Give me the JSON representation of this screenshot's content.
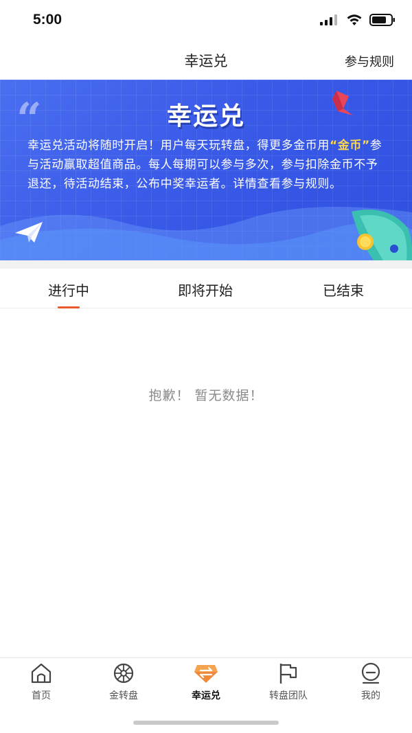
{
  "status_bar": {
    "time": "5:00"
  },
  "nav": {
    "title": "幸运兑",
    "rules_link": "参与规则"
  },
  "banner": {
    "title": "幸运兑",
    "text_before": "幸运兑活动将随时开启！用户每天玩转盘，得更多金币用",
    "highlight": "“金币”",
    "text_after": "参与活动赢取超值商品。每人每期可以参与多次，参与扣除金币不予退还，待活动结束，公布中奖幸运者。详情查看参与规则。"
  },
  "tabs": [
    {
      "label": "进行中",
      "active": true
    },
    {
      "label": "即将开始",
      "active": false
    },
    {
      "label": "已结束",
      "active": false
    }
  ],
  "empty_state": "抱歉！ 暂无数据！",
  "tabbar": [
    {
      "label": "首页",
      "icon": "home-icon",
      "active": false
    },
    {
      "label": "金转盘",
      "icon": "wheel-icon",
      "active": false
    },
    {
      "label": "幸运兑",
      "icon": "exchange-icon",
      "active": true
    },
    {
      "label": "转盘团队",
      "icon": "flag-icon",
      "active": false
    },
    {
      "label": "我的",
      "icon": "profile-icon",
      "active": false
    }
  ],
  "colors": {
    "accent": "#e8582a",
    "banner_blue": "#3a5ae8",
    "highlight_yellow": "#ffd84a"
  }
}
